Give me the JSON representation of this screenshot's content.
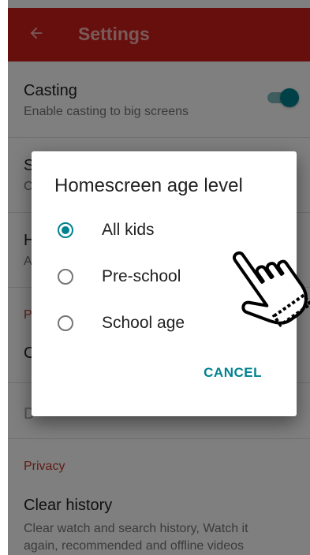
{
  "app_bar": {
    "title": "Settings",
    "back_icon": "arrow-left-icon",
    "color": "#cc1f1a"
  },
  "settings": {
    "casting": {
      "title": "Casting",
      "subtitle": "Enable casting to big screens",
      "enabled": true
    },
    "row2": {
      "title": "S",
      "subtitle": "C"
    },
    "row3": {
      "title": "H",
      "subtitle": "A"
    },
    "section_partial": "P",
    "row4": {
      "title": "C"
    },
    "row5": {
      "title": "D"
    },
    "privacy_header": "Privacy",
    "clear_history": {
      "title": "Clear history",
      "subtitle_line1": "Clear watch and search history, Watch it",
      "subtitle_line2": "again, recommended and offline videos"
    }
  },
  "dialog": {
    "title": "Homescreen age level",
    "options": [
      {
        "label": "All kids",
        "selected": true
      },
      {
        "label": "Pre-school",
        "selected": false
      },
      {
        "label": "School age",
        "selected": false
      }
    ],
    "cancel_label": "CANCEL",
    "accent": "#00838f"
  },
  "cursor": {
    "icon": "hand-pointer-icon"
  }
}
